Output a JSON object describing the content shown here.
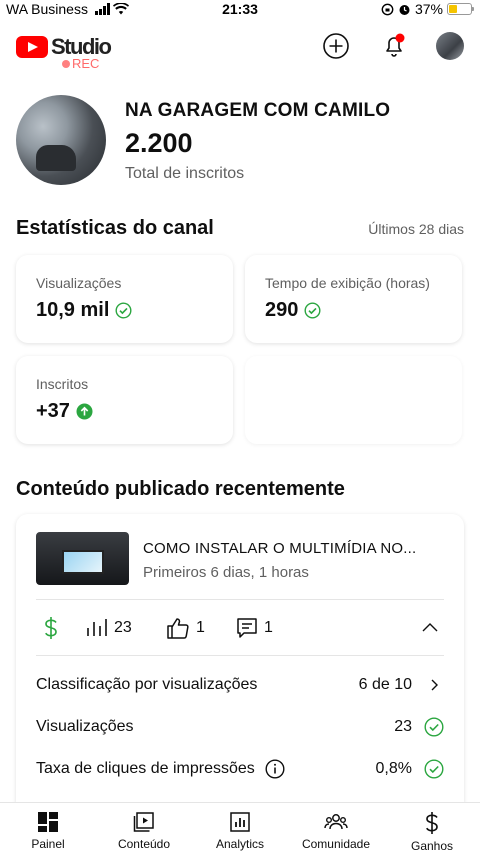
{
  "status_bar": {
    "carrier": "WA Business",
    "time": "21:33",
    "battery": "37%",
    "battery_level": 0.37
  },
  "header": {
    "logo_text": "Studio",
    "rec_label": "REC",
    "create_icon": "plus-circle-icon",
    "notifications_icon": "bell-icon",
    "notification_dot_color": "#ff0000"
  },
  "channel": {
    "name": "NA GARAGEM COM CAMILO",
    "subscribers": "2.200",
    "subscribers_label": "Total de inscritos"
  },
  "stats": {
    "title": "Estatísticas do canal",
    "period": "Últimos 28 dias",
    "cards": [
      {
        "label": "Visualizações",
        "value": "10,9 mil",
        "status_icon": "check-circle-icon"
      },
      {
        "label": "Tempo de exibição (horas)",
        "value": "290",
        "status_icon": "check-circle-icon"
      },
      {
        "label": "Inscritos",
        "value": "+37",
        "status_icon": "arrow-up-circle-icon"
      }
    ]
  },
  "recent": {
    "title": "Conteúdo publicado recentemente",
    "video": {
      "title": "COMO INSTALAR O MULTIMÍDIA NO...",
      "subtitle": "Primeiros 6 dias, 1 horas",
      "views": "23",
      "likes": "1",
      "comments": "1",
      "rows": [
        {
          "label": "Classificação por visualizações",
          "value": "6 de 10"
        },
        {
          "label": "Visualizações",
          "value": "23"
        },
        {
          "label": "Taxa de cliques de impressões",
          "value": "0,8%"
        }
      ]
    }
  },
  "bottom_nav": [
    {
      "label": "Painel",
      "icon": "dashboard-icon"
    },
    {
      "label": "Conteúdo",
      "icon": "content-icon"
    },
    {
      "label": "Analytics",
      "icon": "analytics-icon"
    },
    {
      "label": "Comunidade",
      "icon": "community-icon"
    },
    {
      "label": "Ganhos",
      "icon": "earnings-icon"
    }
  ],
  "colors": {
    "brand_red": "#ff0000",
    "success_green": "#2ba640",
    "text_secondary": "#606060"
  }
}
